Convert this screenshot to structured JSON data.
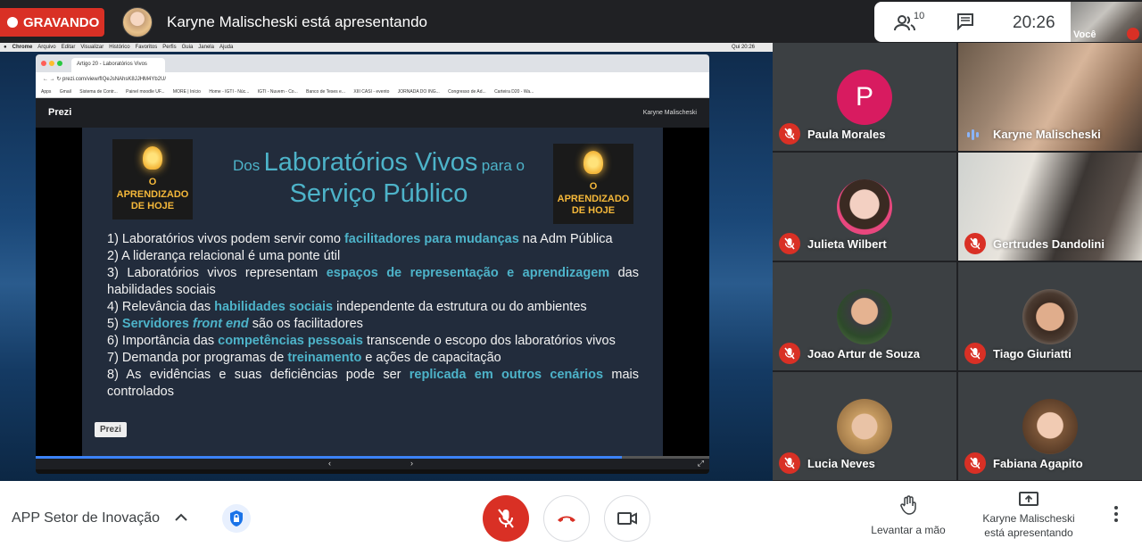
{
  "topbar": {
    "recording_label": "GRAVANDO",
    "presenting_text": "Karyne Malischeski está apresentando",
    "people_count": "10",
    "clock": "20:26",
    "self_label": "Você"
  },
  "shared_screen": {
    "mac_menu": [
      "Chrome",
      "Arquivo",
      "Editar",
      "Visualizar",
      "Histórico",
      "Favoritos",
      "Perfis",
      "Guia",
      "Janela",
      "Ajuda"
    ],
    "mac_clock": "Qui 20:26",
    "browser_tab": "Artigo 20 - Laboratórios Vivos",
    "url": "prezi.com/view/fIQeJsNAhsK8JJHM4Yb2U/",
    "bookmarks": [
      "Apps",
      "Gmail",
      "Sistema de Contr...",
      "Painel moodle UF...",
      "MORE | Início",
      "Home - IGTI - Núc...",
      "IGTI - Nuvem - Co...",
      "Banco de Teses e...",
      "XIII CASI - evento",
      "JORNADA DO ING...",
      "Congresso de Ad...",
      "Carteira D20 - Wa..."
    ],
    "prezi_logo": "Prezi",
    "prezi_user": "Karyne Malischeski",
    "slide": {
      "badge_text": "O APRENDIZADO DE HOJE",
      "title_part1": "Dos",
      "title_part2": "Laboratórios Vivos",
      "title_part3": "para o",
      "title_line2": "Serviço Público",
      "prezi_badge": "Prezi",
      "items": [
        {
          "before": "1) Laboratórios vivos podem servir como ",
          "hl": "facilitadores para mudanças",
          "after": " na Adm Pública"
        },
        {
          "before": "2) A liderança relacional é uma ponte útil",
          "hl": "",
          "after": ""
        },
        {
          "before": "3) Laboratórios vivos representam ",
          "hl": "espaços de representação e aprendizagem",
          "after": " das habilidades sociais"
        },
        {
          "before": "4) Relevância das ",
          "hl": "habilidades sociais",
          "after": " independente da estrutura ou do ambientes"
        },
        {
          "before": "5) ",
          "hl": "Servidores front end",
          "after": " são os facilitadores"
        },
        {
          "before": "6) Importância das ",
          "hl": "competências pessoais",
          "after": " transcende o escopo dos laboratórios vivos"
        },
        {
          "before": "7) Demanda por programas de ",
          "hl": "treinamento",
          "after": " e ações de capacitação"
        },
        {
          "before": "8) As evidências e suas deficiências pode ser ",
          "hl": "replicada em outros cenários",
          "after": " mais controlados"
        }
      ]
    },
    "progress_fraction": 0.87
  },
  "participants": [
    {
      "name": "Paula Morales",
      "initial": "P",
      "muted": true
    },
    {
      "name": "Karyne Malischeski",
      "muted": false
    },
    {
      "name": "Julieta Wilbert",
      "muted": true
    },
    {
      "name": "Gertrudes Dandolini",
      "muted": true
    },
    {
      "name": "Joao Artur de Souza",
      "muted": true
    },
    {
      "name": "Tiago Giuriatti",
      "muted": true
    },
    {
      "name": "Lucia Neves",
      "muted": true
    },
    {
      "name": "Fabiana Agapito",
      "muted": true
    }
  ],
  "bottombar": {
    "meeting_name": "APP Setor de Inovação",
    "raise_hand_label": "Levantar a mão",
    "presenting_line1": "Karyne Malischeski",
    "presenting_line2": "está apresentando"
  },
  "colors": {
    "recording_red": "#d93025",
    "slide_accent": "#4db3c9",
    "avatar_pink": "#d81b60"
  }
}
